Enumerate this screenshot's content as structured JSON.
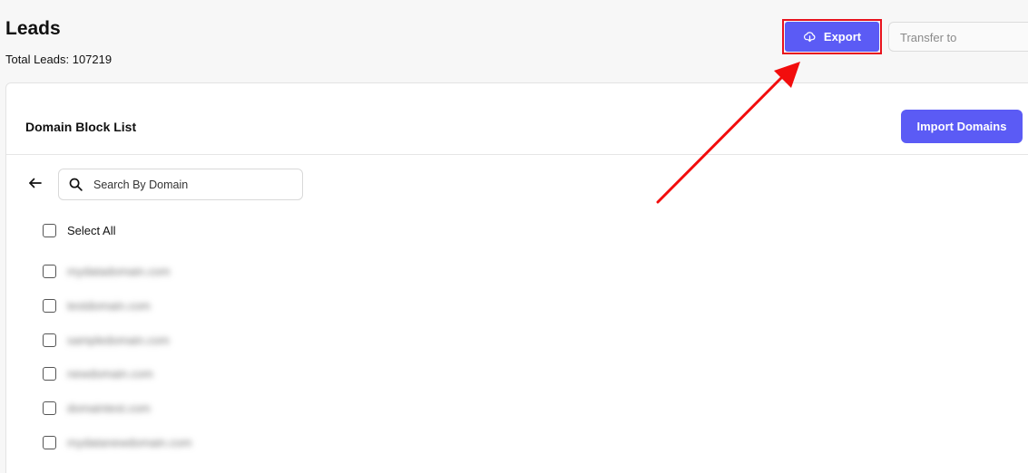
{
  "header": {
    "title": "Leads",
    "total_leads": "Total Leads: 107219",
    "export_label": "Export",
    "transfer_placeholder": "Transfer to"
  },
  "card": {
    "title": "Domain Block List",
    "import_label": "Import Domains",
    "search_placeholder": "Search By Domain",
    "select_all_label": "Select All",
    "domains": [
      "mydatadomain.com",
      "testdomain.com",
      "sampledomain.com",
      "newdomain.com",
      "domaintest.com",
      "mydatanewdomain.com"
    ]
  },
  "icons": {
    "export": "cloud-download-icon",
    "search": "search-icon",
    "back": "arrow-left-icon"
  },
  "colors": {
    "primary": "#5b5bf5",
    "annotation": "#e8121d"
  }
}
